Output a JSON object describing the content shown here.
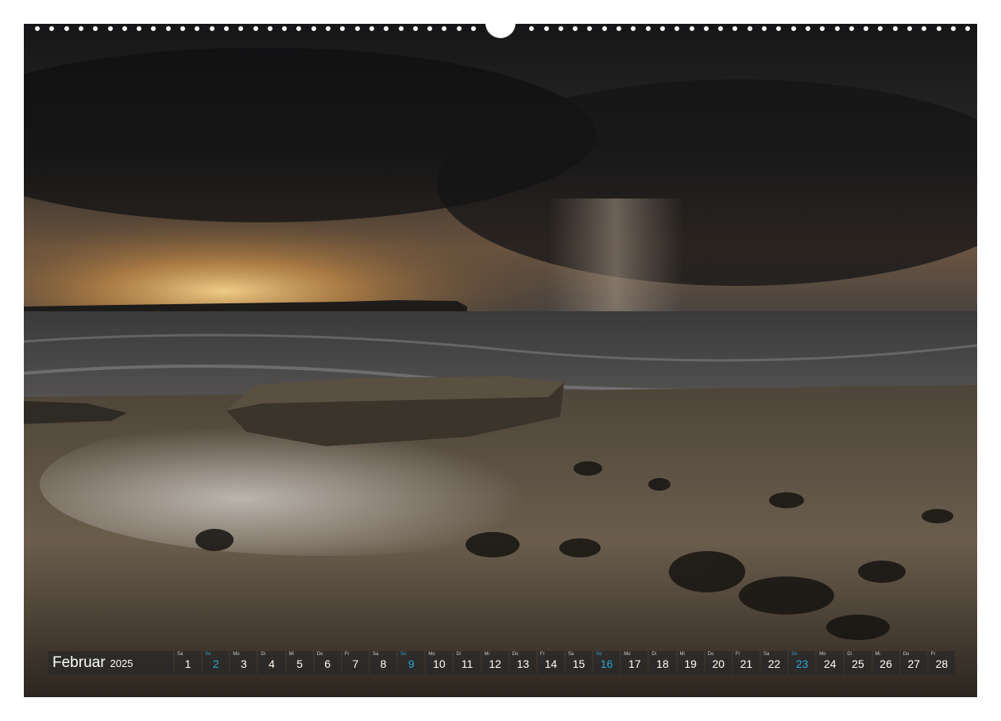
{
  "calendar": {
    "month": "Februar",
    "year": "2025",
    "days": [
      {
        "wd": "Sa",
        "n": "1",
        "sun": false
      },
      {
        "wd": "So",
        "n": "2",
        "sun": true
      },
      {
        "wd": "Mo",
        "n": "3",
        "sun": false
      },
      {
        "wd": "Di",
        "n": "4",
        "sun": false
      },
      {
        "wd": "Mi",
        "n": "5",
        "sun": false
      },
      {
        "wd": "Do",
        "n": "6",
        "sun": false
      },
      {
        "wd": "Fr",
        "n": "7",
        "sun": false
      },
      {
        "wd": "Sa",
        "n": "8",
        "sun": false
      },
      {
        "wd": "So",
        "n": "9",
        "sun": true
      },
      {
        "wd": "Mo",
        "n": "10",
        "sun": false
      },
      {
        "wd": "Di",
        "n": "11",
        "sun": false
      },
      {
        "wd": "Mi",
        "n": "12",
        "sun": false
      },
      {
        "wd": "Do",
        "n": "13",
        "sun": false
      },
      {
        "wd": "Fr",
        "n": "14",
        "sun": false
      },
      {
        "wd": "Sa",
        "n": "15",
        "sun": false
      },
      {
        "wd": "So",
        "n": "16",
        "sun": true
      },
      {
        "wd": "Mo",
        "n": "17",
        "sun": false
      },
      {
        "wd": "Di",
        "n": "18",
        "sun": false
      },
      {
        "wd": "Mi",
        "n": "19",
        "sun": false
      },
      {
        "wd": "Do",
        "n": "20",
        "sun": false
      },
      {
        "wd": "Fr",
        "n": "21",
        "sun": false
      },
      {
        "wd": "Sa",
        "n": "22",
        "sun": false
      },
      {
        "wd": "So",
        "n": "23",
        "sun": true
      },
      {
        "wd": "Mo",
        "n": "24",
        "sun": false
      },
      {
        "wd": "Di",
        "n": "25",
        "sun": false
      },
      {
        "wd": "Mi",
        "n": "26",
        "sun": false
      },
      {
        "wd": "Do",
        "n": "27",
        "sun": false
      },
      {
        "wd": "Fr",
        "n": "28",
        "sun": false
      }
    ]
  },
  "colors": {
    "sunday": "#2aa6d6",
    "bar": "#282828"
  }
}
